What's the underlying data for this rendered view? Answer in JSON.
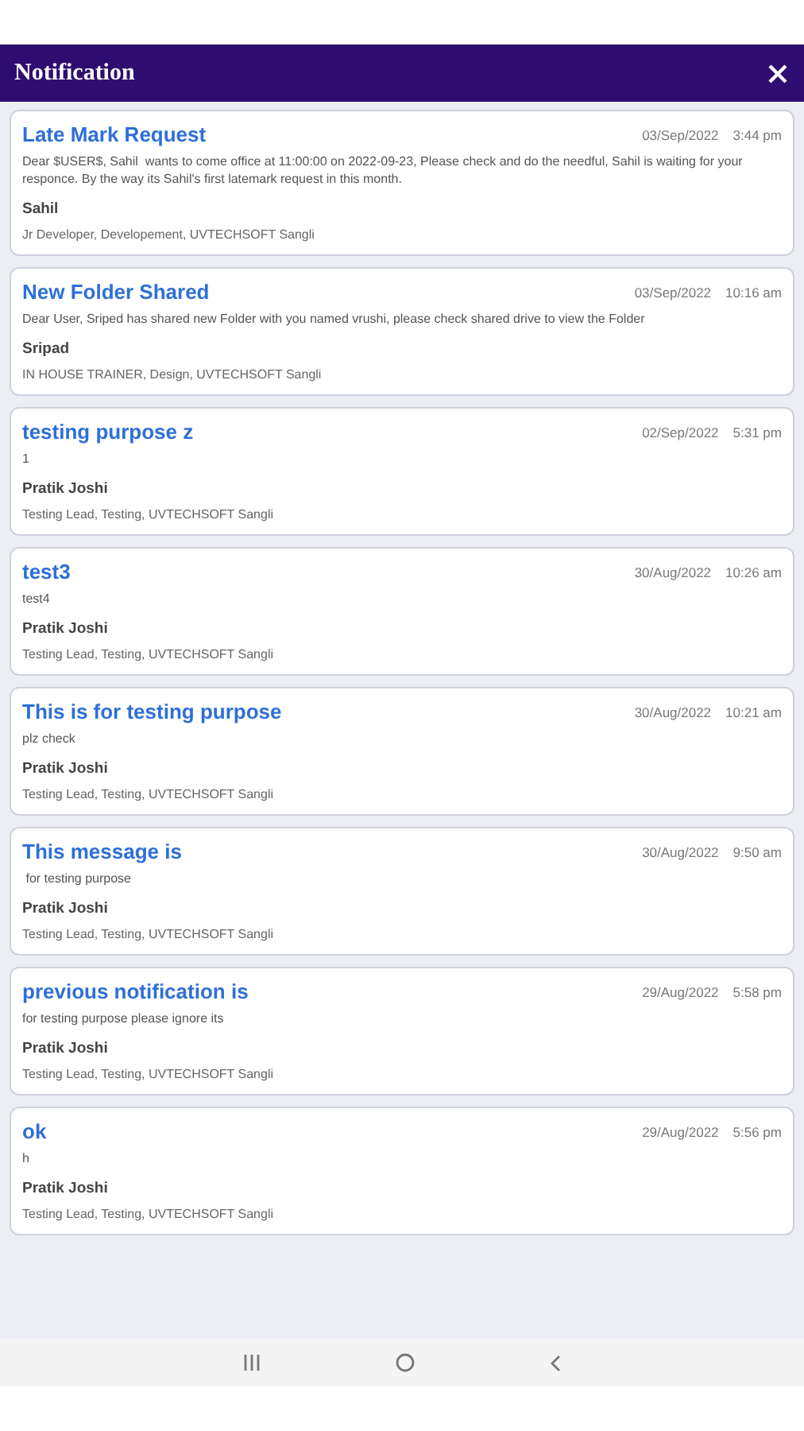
{
  "window": {
    "title": "Notification"
  },
  "notifications": [
    {
      "title": "Late Mark Request",
      "date": "03/Sep/2022",
      "time": "3:44 pm",
      "message": "Dear $USER$, Sahil  wants to come office at 11:00:00 on 2022-09-23, Please check and do the needful, Sahil is waiting for your responce. By the way its Sahil's first latemark request in this month.",
      "sender": "Sahil",
      "role": "Jr Developer, Developement, UVTECHSOFT Sangli"
    },
    {
      "title": "New Folder Shared",
      "date": "03/Sep/2022",
      "time": "10:16 am",
      "message": "Dear User, Sriped has shared new Folder with you named vrushi, please check shared drive to view the Folder",
      "sender": "Sripad",
      "role": "IN HOUSE TRAINER, Design, UVTECHSOFT Sangli"
    },
    {
      "title": "testing purpose z",
      "date": "02/Sep/2022",
      "time": "5:31 pm",
      "message": "1",
      "sender": "Pratik Joshi",
      "role": "Testing Lead, Testing, UVTECHSOFT Sangli"
    },
    {
      "title": "test3",
      "date": "30/Aug/2022",
      "time": "10:26 am",
      "message": "test4",
      "sender": "Pratik Joshi",
      "role": "Testing Lead, Testing, UVTECHSOFT Sangli"
    },
    {
      "title": "This is for testing purpose",
      "date": "30/Aug/2022",
      "time": "10:21 am",
      "message": "plz check",
      "sender": "Pratik Joshi",
      "role": "Testing Lead, Testing, UVTECHSOFT Sangli"
    },
    {
      "title": "This message is",
      "date": "30/Aug/2022",
      "time": "9:50 am",
      "message": " for testing purpose",
      "sender": "Pratik Joshi",
      "role": "Testing Lead, Testing, UVTECHSOFT Sangli"
    },
    {
      "title": "previous notification is",
      "date": "29/Aug/2022",
      "time": "5:58 pm",
      "message": "for testing purpose please ignore its",
      "sender": "Pratik Joshi",
      "role": "Testing Lead, Testing, UVTECHSOFT Sangli"
    },
    {
      "title": "ok",
      "date": "29/Aug/2022",
      "time": "5:56 pm",
      "message": "h",
      "sender": "Pratik Joshi",
      "role": "Testing Lead, Testing, UVTECHSOFT Sangli"
    }
  ]
}
